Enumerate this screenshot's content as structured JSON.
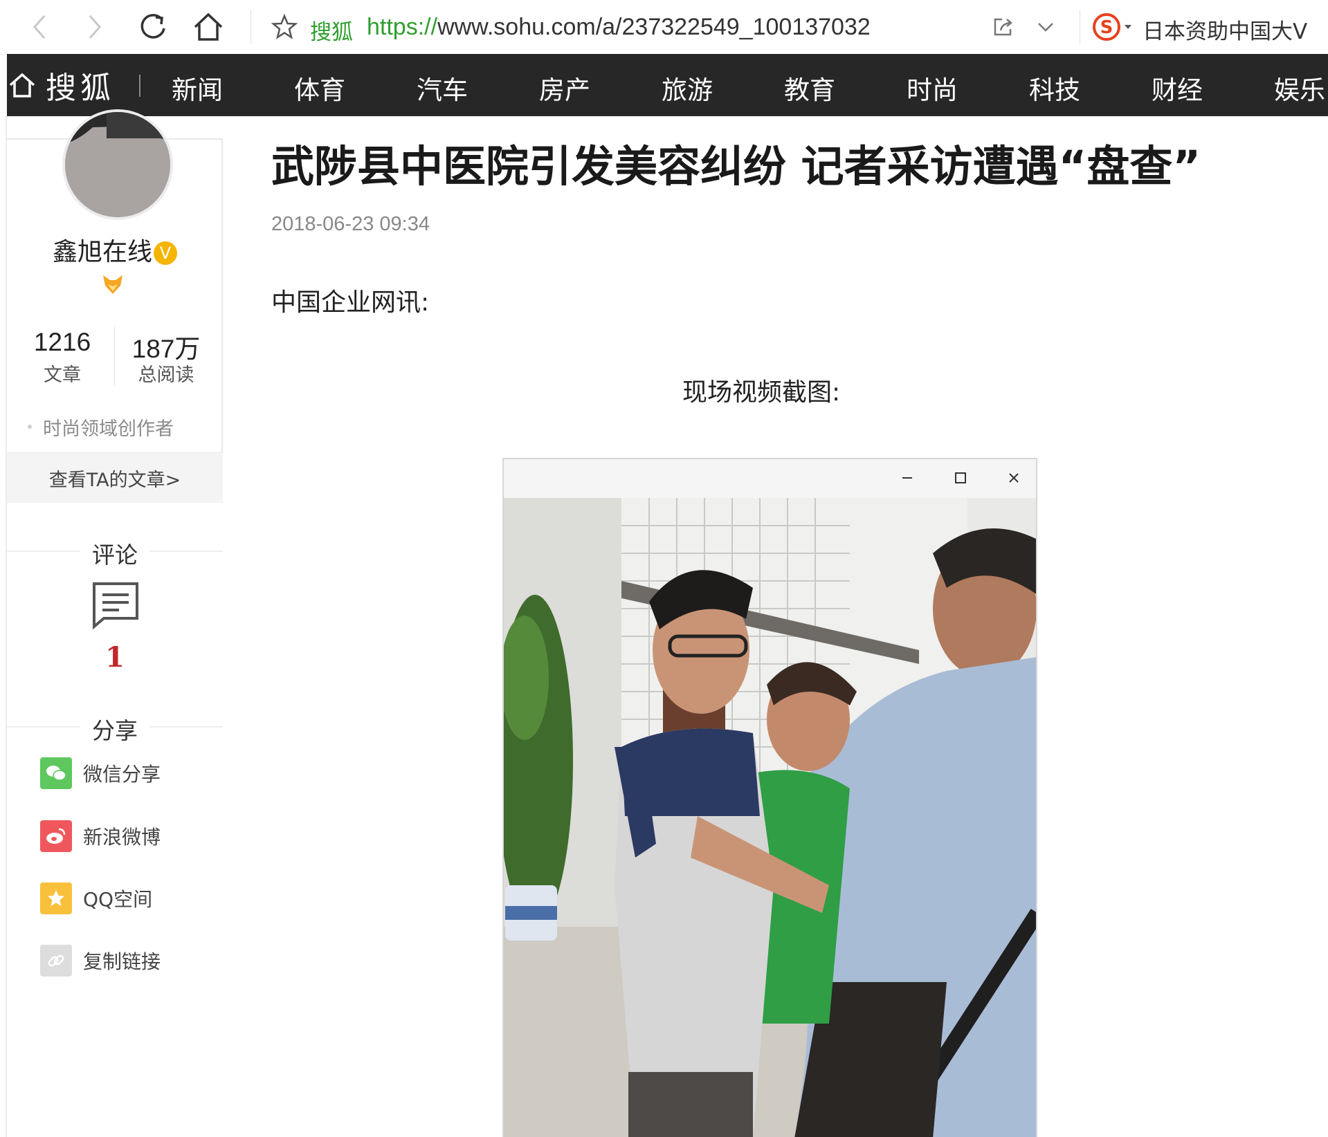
{
  "browser": {
    "site_label": "搜狐",
    "url_scheme": "https://",
    "url_rest": "www.sohu.com/a/237322549_100137032",
    "search_text": "日本资助中国大V"
  },
  "nav": {
    "logo": "搜狐",
    "items": [
      "新闻",
      "体育",
      "汽车",
      "房产",
      "旅游",
      "教育",
      "时尚",
      "科技",
      "财经",
      "娱乐"
    ]
  },
  "author": {
    "name": "鑫旭在线",
    "verified_badge": "V",
    "stats": [
      {
        "value": "1216",
        "label": "文章"
      },
      {
        "value": "187万",
        "label": "总阅读"
      }
    ],
    "field": "时尚领域创作者",
    "view_articles": "查看TA的文章>"
  },
  "comments": {
    "title": "评论",
    "count": "1"
  },
  "share": {
    "title": "分享",
    "items": [
      "微信分享",
      "新浪微博",
      "QQ空间",
      "复制链接"
    ]
  },
  "article": {
    "title": "武陟县中医院引发美容纠纷 记者采访遭遇“盘查”",
    "date": "2018-06-23 09:34",
    "source_line": "中国企业网讯:",
    "video_caption": "现场视频截图:"
  },
  "colors": {
    "nav_bg": "#272727",
    "link_green": "#2f9e2f",
    "comment_count_red": "#c0272d",
    "wechat": "#5ec85e",
    "weibo": "#f0575c",
    "qzone": "#f8c03b",
    "copy_link": "#dddddd"
  }
}
